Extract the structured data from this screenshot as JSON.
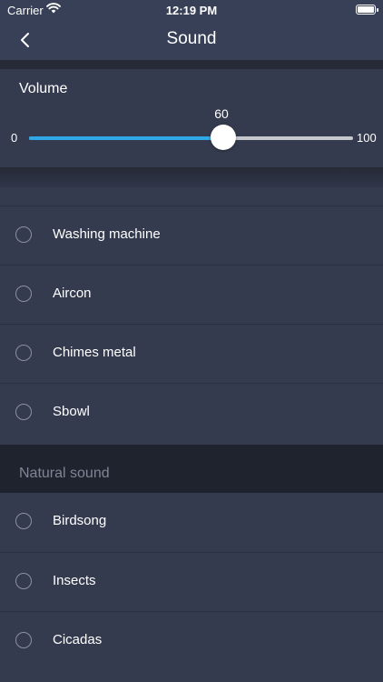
{
  "status_bar": {
    "carrier": "Carrier",
    "time": "12:19 PM"
  },
  "nav": {
    "title": "Sound",
    "back_icon": "chevron-left-icon"
  },
  "volume": {
    "label": "Volume",
    "value": "60",
    "min": "0",
    "max": "100",
    "fraction": 0.6,
    "accent": "#2fa8e8"
  },
  "sounds": [
    {
      "label": "Washing machine",
      "selected": false
    },
    {
      "label": "Aircon",
      "selected": false
    },
    {
      "label": "Chimes metal",
      "selected": false
    },
    {
      "label": "Sbowl",
      "selected": false
    }
  ],
  "natural_section": {
    "title": "Natural sound",
    "items": [
      {
        "label": "Birdsong",
        "selected": false
      },
      {
        "label": "Insects",
        "selected": false
      },
      {
        "label": "Cicadas",
        "selected": false
      }
    ]
  }
}
